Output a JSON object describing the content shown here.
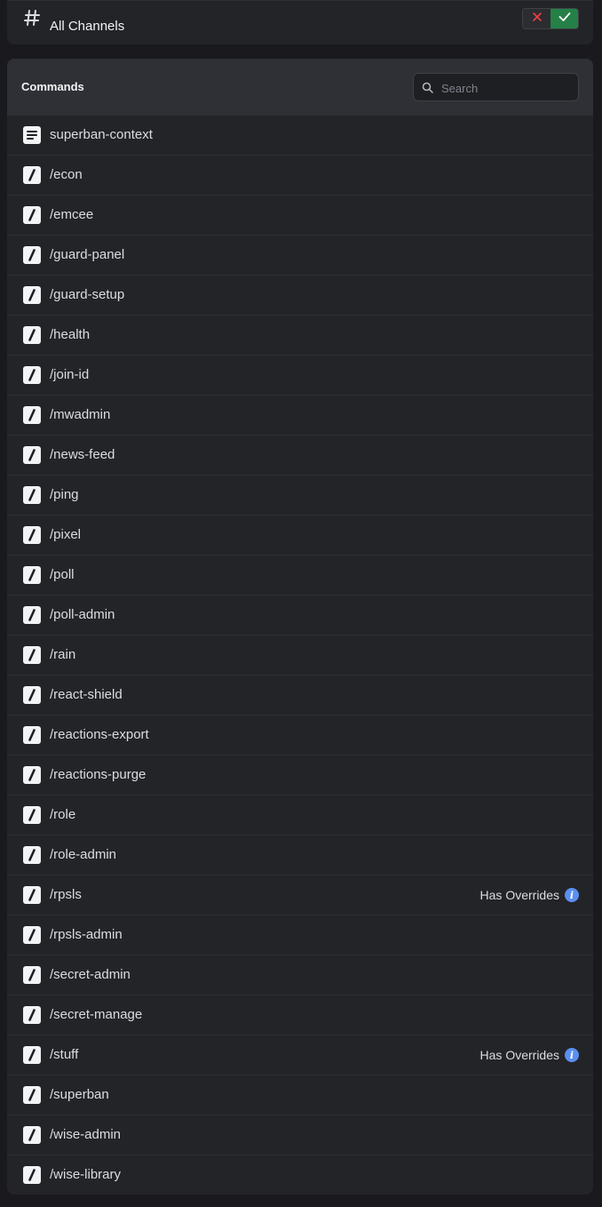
{
  "channel": {
    "label": "All Channels",
    "deny_icon": "x-icon",
    "allow_icon": "check-icon",
    "state": "allowed"
  },
  "panel": {
    "title": "Commands",
    "search_placeholder": "Search"
  },
  "commands": [
    {
      "name": "superban-context",
      "icon": "context-menu-icon"
    },
    {
      "name": "/econ",
      "icon": "slash-command-icon"
    },
    {
      "name": "/emcee",
      "icon": "slash-command-icon"
    },
    {
      "name": "/guard-panel",
      "icon": "slash-command-icon"
    },
    {
      "name": "/guard-setup",
      "icon": "slash-command-icon"
    },
    {
      "name": "/health",
      "icon": "slash-command-icon"
    },
    {
      "name": "/join-id",
      "icon": "slash-command-icon"
    },
    {
      "name": "/mwadmin",
      "icon": "slash-command-icon"
    },
    {
      "name": "/news-feed",
      "icon": "slash-command-icon"
    },
    {
      "name": "/ping",
      "icon": "slash-command-icon"
    },
    {
      "name": "/pixel",
      "icon": "slash-command-icon"
    },
    {
      "name": "/poll",
      "icon": "slash-command-icon"
    },
    {
      "name": "/poll-admin",
      "icon": "slash-command-icon"
    },
    {
      "name": "/rain",
      "icon": "slash-command-icon"
    },
    {
      "name": "/react-shield",
      "icon": "slash-command-icon"
    },
    {
      "name": "/reactions-export",
      "icon": "slash-command-icon"
    },
    {
      "name": "/reactions-purge",
      "icon": "slash-command-icon"
    },
    {
      "name": "/role",
      "icon": "slash-command-icon"
    },
    {
      "name": "/role-admin",
      "icon": "slash-command-icon"
    },
    {
      "name": "/rpsls",
      "icon": "slash-command-icon",
      "badge": "Has Overrides"
    },
    {
      "name": "/rpsls-admin",
      "icon": "slash-command-icon"
    },
    {
      "name": "/secret-admin",
      "icon": "slash-command-icon"
    },
    {
      "name": "/secret-manage",
      "icon": "slash-command-icon"
    },
    {
      "name": "/stuff",
      "icon": "slash-command-icon",
      "badge": "Has Overrides"
    },
    {
      "name": "/superban",
      "icon": "slash-command-icon"
    },
    {
      "name": "/wise-admin",
      "icon": "slash-command-icon"
    },
    {
      "name": "/wise-library",
      "icon": "slash-command-icon"
    }
  ],
  "colors": {
    "background": "#1a1a1e",
    "panel": "#232428",
    "header": "#2f3035",
    "allow_green": "#248046",
    "deny_red": "#f23f43",
    "info_blue": "#5b8ff0"
  }
}
